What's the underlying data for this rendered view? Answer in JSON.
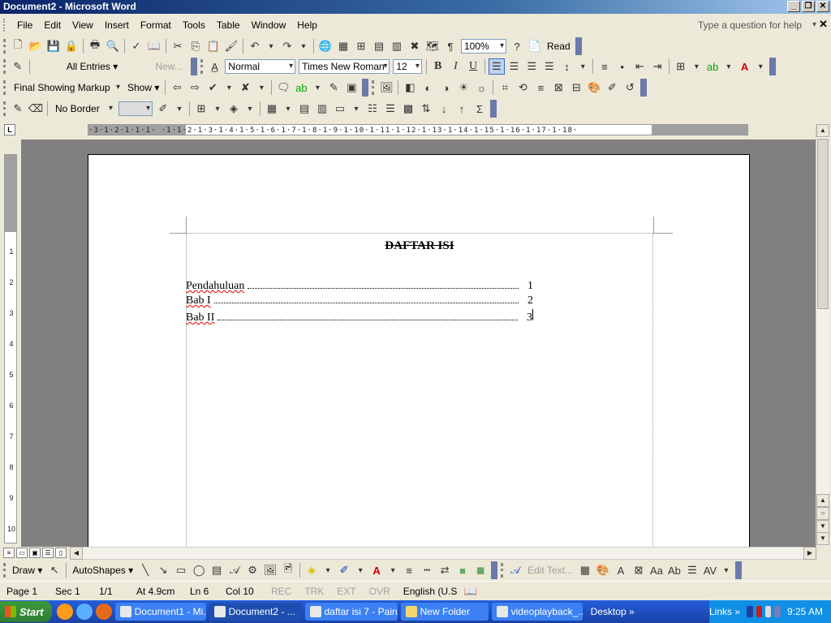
{
  "window": {
    "title": "Document2 - Microsoft Word",
    "minimize": "_",
    "restore": "❐",
    "close": "✕",
    "doc_close": "✕"
  },
  "menu": {
    "items": [
      "File",
      "Edit",
      "View",
      "Insert",
      "Format",
      "Tools",
      "Table",
      "Window",
      "Help"
    ],
    "help_placeholder": "Type a question for help"
  },
  "standard_toolbar": {
    "zoom": "100%",
    "read_label": "Read"
  },
  "mail_toolbar": {
    "entries": "All Entries ▾",
    "new": "New..."
  },
  "formatting_toolbar": {
    "style": "Normal",
    "font": "Times New Roman",
    "size": "12",
    "bold": "B",
    "italic": "I",
    "underline": "U"
  },
  "reviewing_toolbar": {
    "markup": "Final Showing Markup",
    "show": "Show ▾"
  },
  "tables_toolbar": {
    "border": "No Border",
    "sum": "Σ"
  },
  "ruler": {
    "tab_button": "L",
    "ticks": "·3·1·2·1·1·1·  ·1·1·2·1·3·1·4·1·5·1·6·1·7·1·8·1·9·1·10·1·11·1·12·1·13·1·14·1·15·1·16·1·17·1·18·",
    "vticks": [
      "1",
      "2",
      "3",
      "4",
      "5",
      "6",
      "7",
      "8",
      "9",
      "10"
    ]
  },
  "document": {
    "heading": "DAFTAR ISI",
    "toc": [
      {
        "label": "Pendahuluan",
        "page": "1"
      },
      {
        "label": "Bab I",
        "page": "2"
      },
      {
        "label": "Bab II",
        "page": "3"
      }
    ]
  },
  "drawing_toolbar": {
    "draw": "Draw ▾",
    "autoshapes": "AutoShapes ▾",
    "edit_text": "Edit Text..."
  },
  "status": {
    "page": "Page 1",
    "sec": "Sec 1",
    "pages": "1/1",
    "at": "At 4.9cm",
    "ln": "Ln 6",
    "col": "Col 10",
    "rec": "REC",
    "trk": "TRK",
    "ext": "EXT",
    "ovr": "OVR",
    "language": "English (U.S"
  },
  "taskbar": {
    "start": "Start",
    "tasks": [
      {
        "label": "Document1 - Mi...",
        "active": false
      },
      {
        "label": "Document2 - ...",
        "active": true
      },
      {
        "label": "daftar isi 7 - Paint",
        "active": false
      },
      {
        "label": "New Folder",
        "active": false
      },
      {
        "label": "videoplayback_...",
        "active": false
      }
    ],
    "desktop": "Desktop",
    "links": "Links",
    "clock": "9:25 AM",
    "more": "»"
  }
}
